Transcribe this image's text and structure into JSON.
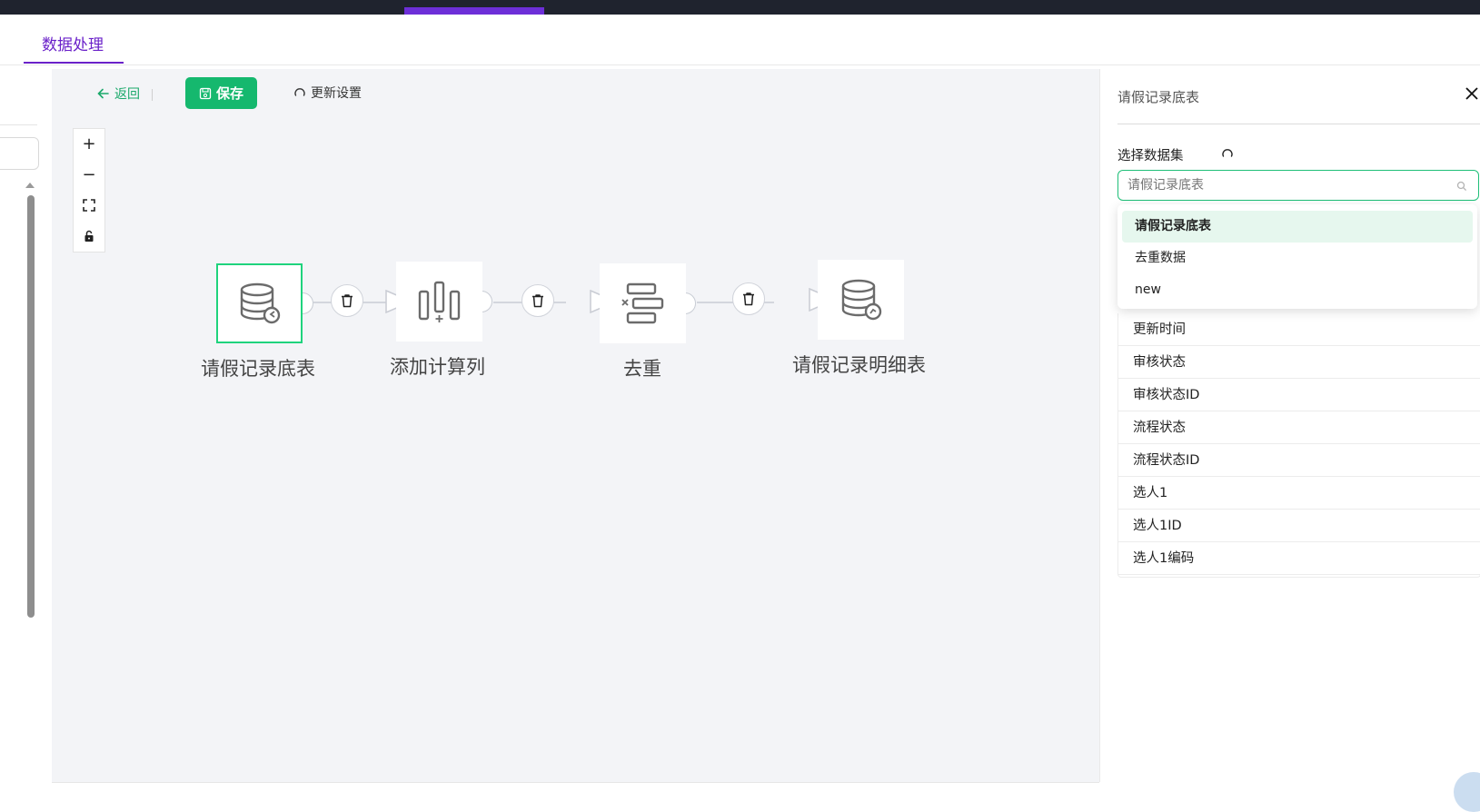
{
  "tab": {
    "label": "数据处理"
  },
  "toolbar": {
    "back_label": "返回",
    "save_label": "保存",
    "refresh_label": "更新设置"
  },
  "zoom_controls": {
    "zoom_in": "+",
    "zoom_out": "−"
  },
  "flow": {
    "nodes": [
      {
        "label": "请假记录底表",
        "icon": "database-input-icon",
        "selected": true
      },
      {
        "label": "添加计算列",
        "icon": "compute-column-icon",
        "selected": false
      },
      {
        "label": "去重",
        "icon": "dedupe-icon",
        "selected": false
      },
      {
        "label": "请假记录明细表",
        "icon": "database-output-icon",
        "selected": false
      }
    ]
  },
  "side_panel": {
    "title": "请假记录底表",
    "close_icon": "close-icon",
    "dataset_label": "选择数据集",
    "dataset_placeholder": "请假记录底表",
    "dropdown_options": [
      "请假记录底表",
      "去重数据",
      "new"
    ],
    "dropdown_selected": "请假记录底表",
    "fields": [
      "更新时间",
      "审核状态",
      "审核状态ID",
      "流程状态",
      "流程状态ID",
      "选人1",
      "选人1ID",
      "选人1编码"
    ]
  },
  "colors": {
    "accent_purple": "#6a21c9",
    "primary_green": "#15b86e",
    "canvas_bg": "#f3f4f7",
    "topbar": "#1f232e"
  }
}
